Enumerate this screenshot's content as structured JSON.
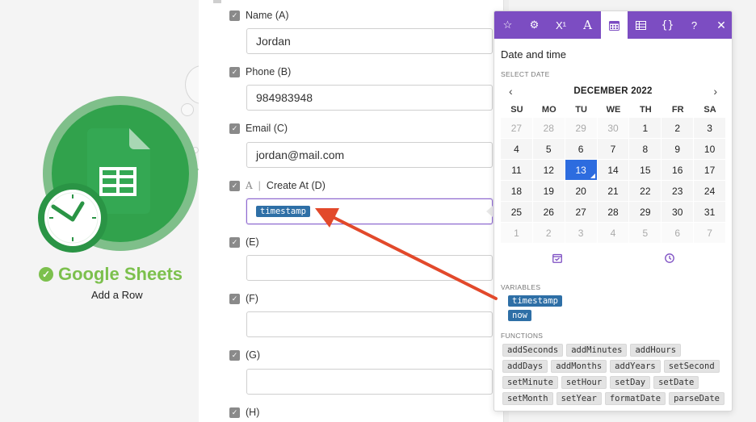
{
  "module": {
    "name": "Google Sheets",
    "action": "Add a Row",
    "brand_color": "#31a24c",
    "title_color": "#7cc04d"
  },
  "form": {
    "fields": [
      {
        "label": "Name (A)",
        "value": ""
      },
      {
        "label": "Phone (B)",
        "value": ""
      },
      {
        "label": "Email (C)",
        "value": ""
      },
      {
        "label": "Create At (D)",
        "value": "",
        "token": "timestamp"
      },
      {
        "label": "(E)",
        "value": ""
      },
      {
        "label": "(F)",
        "value": ""
      },
      {
        "label": "(G)",
        "value": ""
      },
      {
        "label": "(H)",
        "value": ""
      }
    ],
    "values": [
      "Jordan",
      "984983948",
      "jordan@mail.com"
    ]
  },
  "popover": {
    "toolbar": [
      "star-icon",
      "gear-icon",
      "superscript-icon",
      "text-icon",
      "calendar-icon",
      "table-icon",
      "braces-icon",
      "help-icon",
      "close-icon"
    ],
    "accent": "#7c4dc2",
    "title": "Date and time",
    "select_date_label": "SELECT DATE",
    "month": "DECEMBER 2022",
    "prev": "‹",
    "next": "›",
    "weekdays": [
      "SU",
      "MO",
      "TU",
      "WE",
      "TH",
      "FR",
      "SA"
    ],
    "days": [
      "27",
      "28",
      "29",
      "30",
      "1",
      "2",
      "3",
      "4",
      "5",
      "6",
      "7",
      "8",
      "9",
      "10",
      "11",
      "12",
      "13",
      "14",
      "15",
      "16",
      "17",
      "18",
      "19",
      "20",
      "21",
      "22",
      "23",
      "24",
      "25",
      "26",
      "27",
      "28",
      "29",
      "30",
      "31",
      "1",
      "2",
      "3",
      "4",
      "5",
      "6",
      "7"
    ],
    "selected_day": "13",
    "variables_label": "VARIABLES",
    "variables": [
      "timestamp",
      "now"
    ],
    "functions_label": "FUNCTIONS",
    "functions": [
      "addSeconds",
      "addMinutes",
      "addHours",
      "addDays",
      "addMonths",
      "addYears",
      "setSecond",
      "setMinute",
      "setHour",
      "setDay",
      "setDate",
      "setMonth",
      "setYear",
      "formatDate",
      "parseDate"
    ]
  }
}
